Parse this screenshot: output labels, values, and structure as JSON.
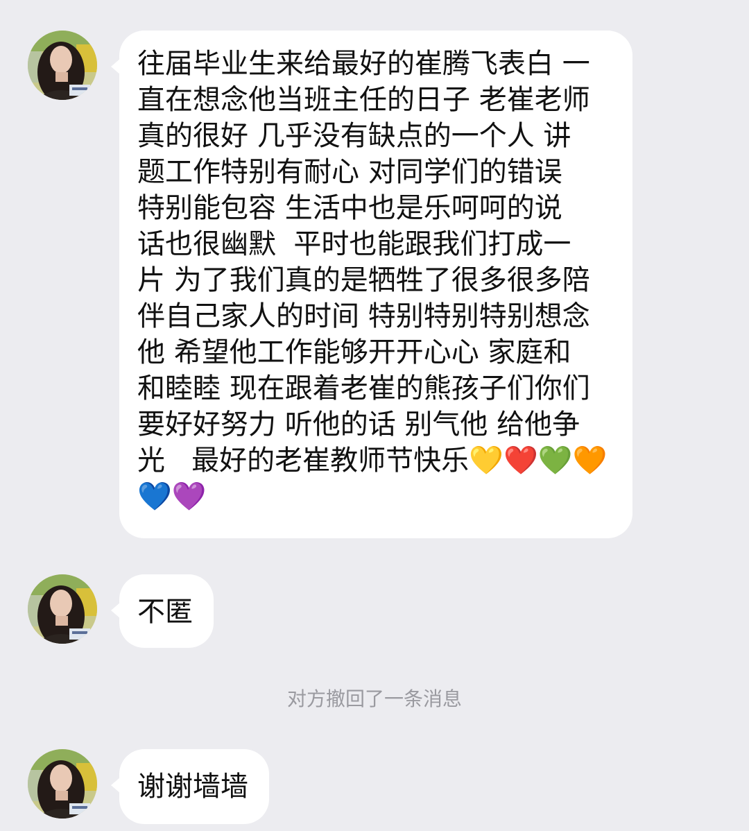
{
  "messages": [
    {
      "sender": "other",
      "text": "往届毕业生来给最好的崔腾飞表白 一\n直在想念他当班主任的日子 老崔老师\n真的很好 几乎没有缺点的一个人 讲\n题工作特别有耐心 对同学们的错误\n特别能包容 生活中也是乐呵呵的说\n话也很幽默  平时也能跟我们打成一\n片 为了我们真的是牺牲了很多很多陪\n伴自己家人的时间 特别特别特别想念\n他 希望他工作能够开开心心 家庭和\n和睦睦 现在跟着老崔的熊孩子们你们\n要好好努力 听他的话 别气他 给他争\n光   最好的老崔教师节快乐💛❤️💚🧡\n💙💜"
    },
    {
      "sender": "other",
      "text": "不匿"
    },
    {
      "sender": "other",
      "text": "谢谢墙墙"
    }
  ],
  "system_notice": "对方撤回了一条消息",
  "colors": {
    "background": "#ececf0",
    "bubble": "#ffffff",
    "text": "#111111",
    "notice_text": "#9a9aa0"
  }
}
